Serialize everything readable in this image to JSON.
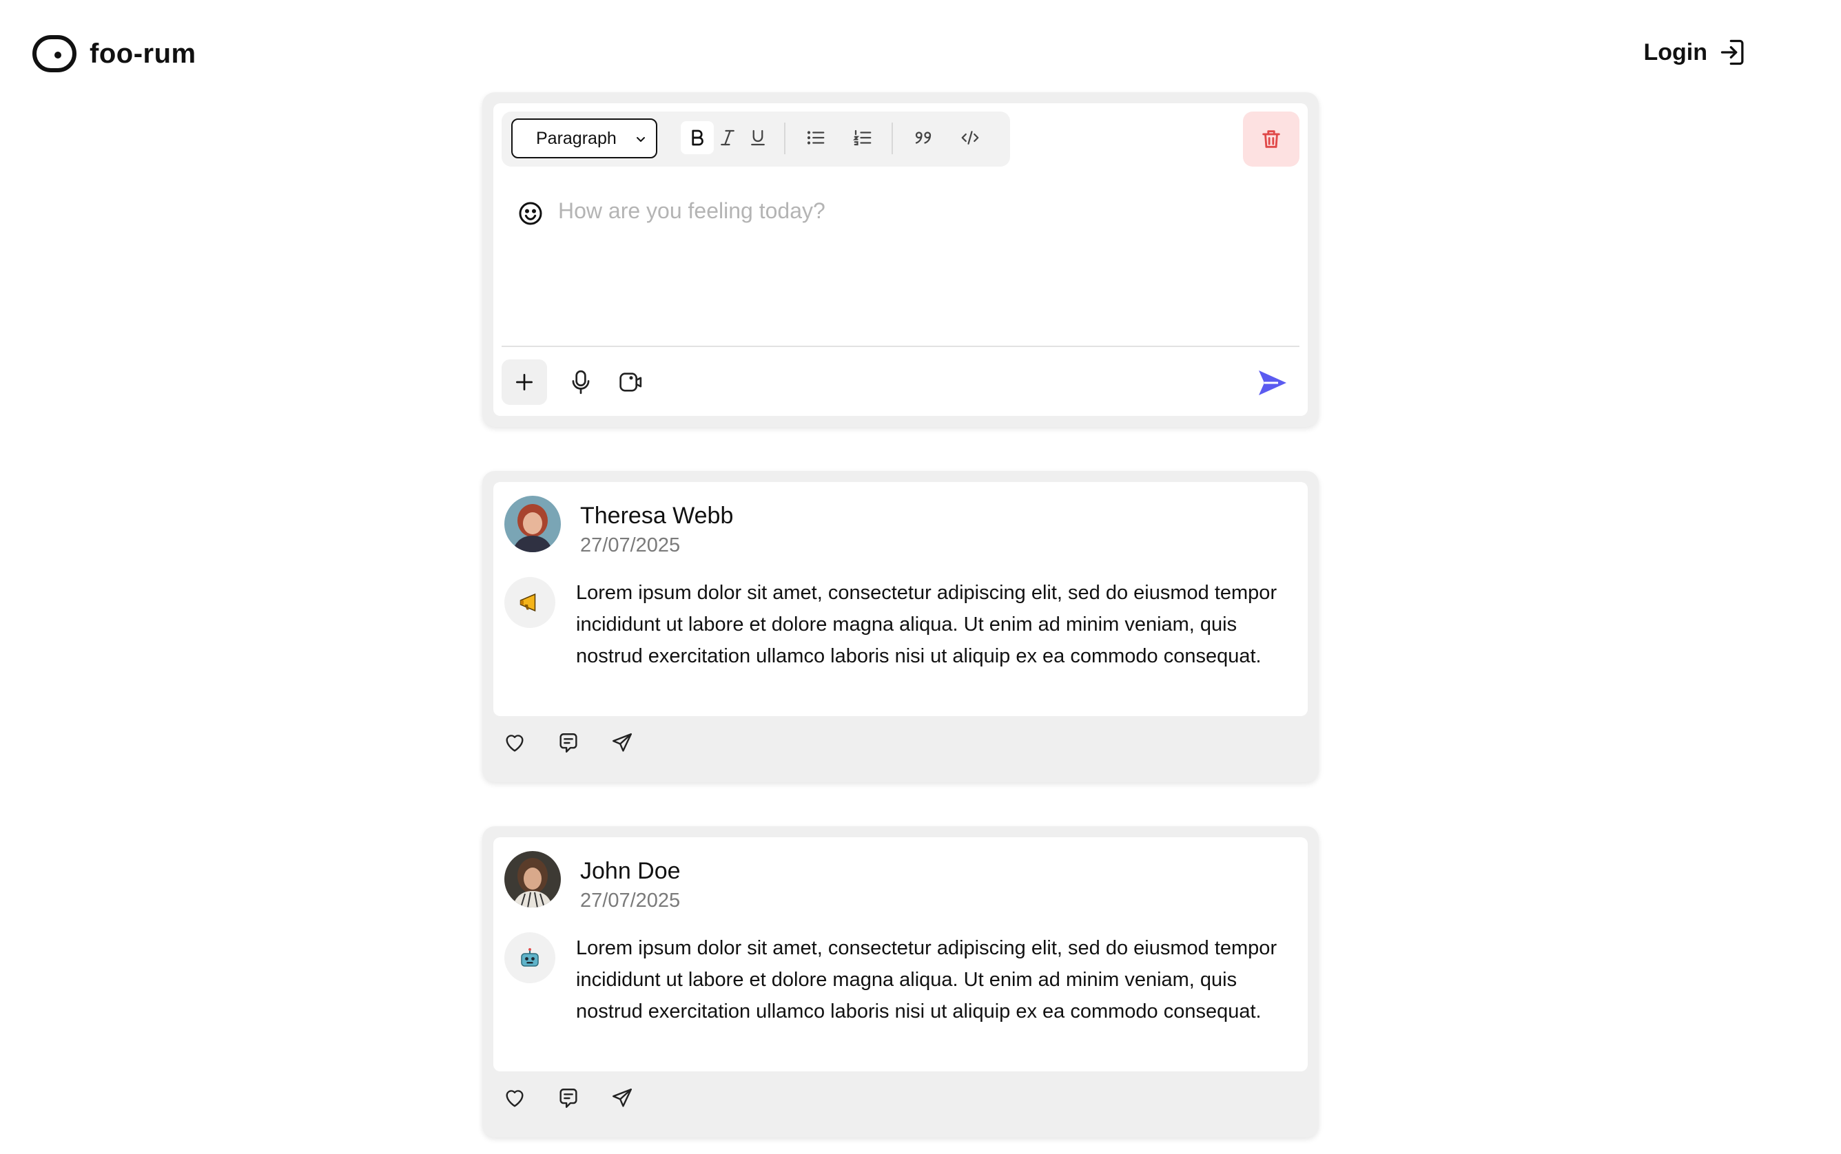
{
  "header": {
    "logo_text": "foo-rum",
    "login_label": "Login"
  },
  "editor": {
    "block_type": "Paragraph",
    "placeholder": "How are you feeling today?",
    "toolbar_icons": [
      "bold-icon",
      "italic-icon",
      "underline-icon",
      "bullet-list-icon",
      "numbered-list-icon",
      "quote-icon",
      "code-icon"
    ],
    "delete_icon": "trash-icon",
    "footer_icons": [
      "plus-icon",
      "microphone-icon",
      "camera-icon",
      "send-icon"
    ]
  },
  "posts": [
    {
      "author": "Theresa Webb",
      "date": "27/07/2025",
      "mood_icon": "megaphone-emoji",
      "text": "Lorem ipsum dolor sit amet, consectetur adipiscing elit, sed do eiusmod tempor incididunt ut labore et dolore magna aliqua. Ut enim ad minim veniam, quis nostrud exercitation ullamco laboris nisi ut aliquip ex ea commodo consequat."
    },
    {
      "author": "John Doe",
      "date": "27/07/2025",
      "mood_icon": "robot-emoji",
      "text": "Lorem ipsum dolor sit amet, consectetur adipiscing elit, sed do eiusmod tempor incididunt ut labore et dolore magna aliqua. Ut enim ad minim veniam, quis nostrud exercitation ullamco laboris nisi ut aliquip ex ea commodo consequat."
    }
  ],
  "post_actions": [
    "heart-icon",
    "comment-icon",
    "share-icon"
  ],
  "colors": {
    "accent": "#5b5bf0",
    "danger": "#e04848",
    "danger_bg": "#fde1e1",
    "card_bg": "#efefef",
    "muted_text": "#7a7a7a"
  }
}
